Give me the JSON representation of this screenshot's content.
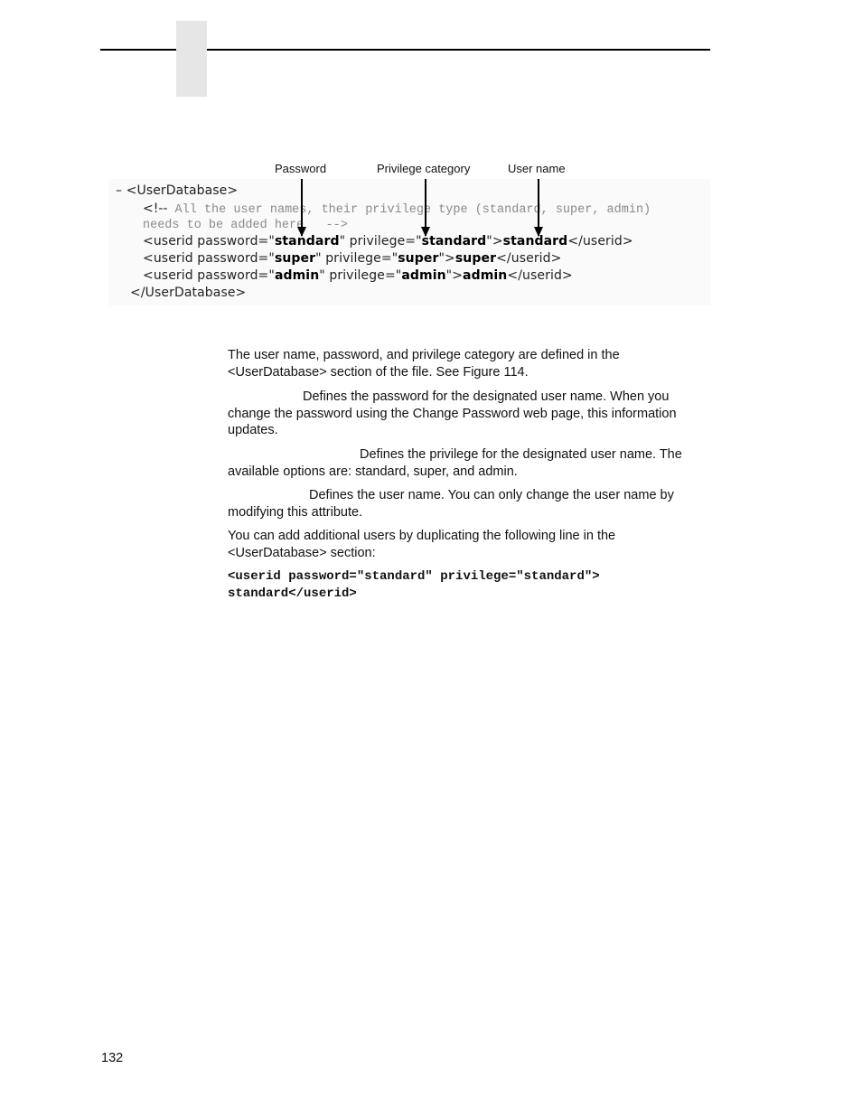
{
  "page": {
    "number": "132"
  },
  "figure": {
    "callouts": {
      "password": "Password",
      "privilege": "Privilege category",
      "username": "User name"
    },
    "xml": {
      "open_tag": "– <UserDatabase>",
      "comment_open": "<!--",
      "comment_line1": " All the user names, their privilege type (standard, super, admin)",
      "comment_line2": "needs to be added here   -->",
      "rows": [
        {
          "prefix": "<userid password=\"",
          "password": "standard",
          "mid": "\" privilege=\"",
          "privilege": "standard",
          "mid2": "\">",
          "user": "standard",
          "close": "</userid>"
        },
        {
          "prefix": "<userid password=\"",
          "password": "super",
          "mid": "\" privilege=\"",
          "privilege": "super",
          "mid2": "\">",
          "user": "super",
          "close": "</userid>"
        },
        {
          "prefix": "<userid password=\"",
          "password": "admin",
          "mid": "\" privilege=\"",
          "privilege": "admin",
          "mid2": "\">",
          "user": "admin",
          "close": "</userid>"
        }
      ],
      "close_tag": "</UserDatabase>"
    }
  },
  "body": {
    "intro": "The user name, password, and privilege category are defined in the <UserDatabase> section of the file. See Figure 114.",
    "password_desc": "Defines the password for the designated user name. When you change the password using the Change Password web page, this information updates.",
    "privilege_desc": "Defines the privilege for the designated user name. The available options are: standard, super, and admin.",
    "username_desc": "Defines the user name. You can only change the user name by modifying this attribute.",
    "add_users": "You can add additional users by duplicating the following line in the <UserDatabase> section:",
    "code_line1": "<userid password=\"standard\" privilege=\"standard\">",
    "code_line2": "standard</userid>"
  }
}
